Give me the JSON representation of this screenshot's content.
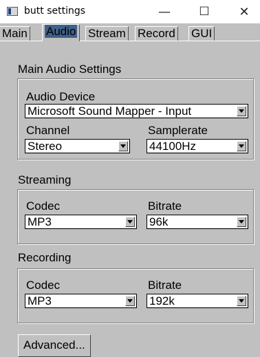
{
  "window": {
    "title": "butt settings",
    "minimize": "—",
    "maximize": "☐",
    "close": "✕"
  },
  "tabs": [
    "Main",
    "Audio",
    "Stream",
    "Record",
    "GUI"
  ],
  "main_audio": {
    "heading": "Main Audio Settings",
    "device_label": "Audio Device",
    "device_value": "Microsoft Sound Mapper - Input",
    "channel_label": "Channel",
    "channel_value": "Stereo",
    "samplerate_label": "Samplerate",
    "samplerate_value": "44100Hz"
  },
  "streaming": {
    "heading": "Streaming",
    "codec_label": "Codec",
    "codec_value": "MP3",
    "bitrate_label": "Bitrate",
    "bitrate_value": "96k"
  },
  "recording": {
    "heading": "Recording",
    "codec_label": "Codec",
    "codec_value": "MP3",
    "bitrate_label": "Bitrate",
    "bitrate_value": "192k"
  },
  "advanced_button": "Advanced...",
  "colors": {
    "active_tab": "#40608a",
    "background": "#c0c0c0"
  }
}
